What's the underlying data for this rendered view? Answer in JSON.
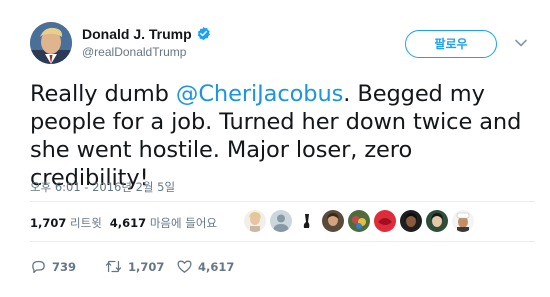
{
  "author": {
    "name": "Donald J. Trump",
    "handle": "@realDonaldTrump",
    "verified_icon": "verified-badge-icon",
    "avatar_icon": "profile-avatar"
  },
  "follow_button": {
    "label": "팔로우"
  },
  "menu": {
    "icon": "chevron-down-icon"
  },
  "tweet": {
    "text_before": "Really dumb ",
    "mention": "@CheriJacobus",
    "text_after": ". Begged my people for a job. Turned her down twice and she went hostile. Major loser, zero credibility!"
  },
  "timestamp": "오후 6:01 - 2016년 2월 5일",
  "stats": {
    "retweets_count": "1,707",
    "retweets_label": "리트윗",
    "likes_count": "4,617",
    "likes_label": "마음에 들어요"
  },
  "actions": {
    "reply_count": "739",
    "retweet_count": "1,707",
    "like_count": "4,617",
    "reply_icon": "reply-icon",
    "retweet_icon": "retweet-icon",
    "like_icon": "heart-icon"
  },
  "colors": {
    "accent": "#1da1f2",
    "mention": "#1b95e0",
    "muted": "#657786",
    "text": "#14171a",
    "divider": "#e6ecf0"
  }
}
